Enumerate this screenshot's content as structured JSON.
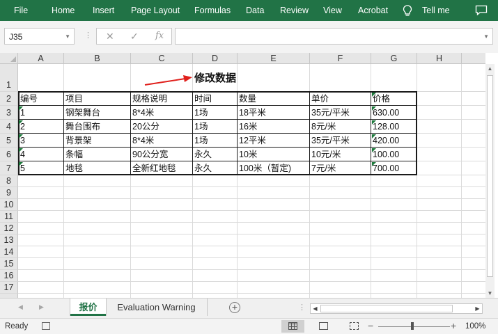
{
  "ribbon": {
    "tabs": [
      "File",
      "Home",
      "Insert",
      "Page Layout",
      "Formulas",
      "Data",
      "Review",
      "View",
      "Acrobat"
    ],
    "tell_me": "Tell me",
    "color": "#217346"
  },
  "formula_bar": {
    "name_box": "J35",
    "cancel_icon": "✕",
    "enter_icon": "✓",
    "fx_label": "fx",
    "value": ""
  },
  "sheet": {
    "columns": [
      "A",
      "B",
      "C",
      "D",
      "E",
      "F",
      "G",
      "H"
    ],
    "rows": [
      "1",
      "2",
      "3",
      "4",
      "5",
      "6",
      "7",
      "8",
      "9",
      "10",
      "11",
      "12",
      "13",
      "14",
      "15",
      "16",
      "17"
    ],
    "title": "修改数据",
    "headers": [
      "编号",
      "项目",
      "规格说明",
      "时间",
      "数量",
      "单价",
      "价格"
    ],
    "data": [
      [
        "1",
        "钢架舞台",
        "8*4米",
        "1场",
        "18平米",
        "35元/平米",
        "630.00"
      ],
      [
        "2",
        "舞台围布",
        "20公分",
        "1场",
        "16米",
        "8元/米",
        "128.00"
      ],
      [
        "3",
        "背景架",
        "8*4米",
        "1场",
        "12平米",
        "35元/平米",
        "420.00"
      ],
      [
        "4",
        "条幅",
        "90公分宽",
        "永久",
        "10米",
        "10元/米",
        "100.00"
      ],
      [
        "5",
        "地毯",
        "全新红地毯",
        "永久",
        "100米（暂定)",
        "7元/米",
        "700.00"
      ]
    ]
  },
  "sheet_tabs": {
    "active": "报价",
    "other": "Evaluation Warning",
    "add": "+"
  },
  "status_bar": {
    "ready": "Ready",
    "zoom": "100%",
    "zoom_minus": "−",
    "zoom_plus": "+"
  }
}
